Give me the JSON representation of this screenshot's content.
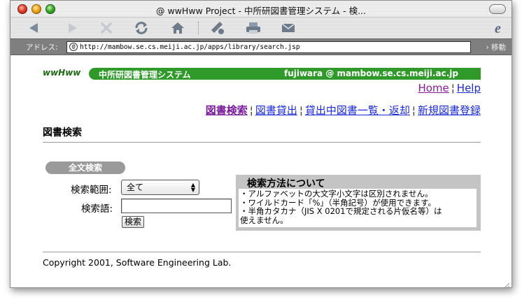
{
  "window": {
    "title": "@ wwHww Project - 中所研図書管理システム  - 検..."
  },
  "address": {
    "label": "アドレス:",
    "url": "http://mambow.se.cs.meiji.ac.jp/apps/library/search.jsp",
    "go_label": "› 移動"
  },
  "toolbar": {
    "icons": [
      "back-icon",
      "forward-icon",
      "stop-icon",
      "refresh-icon",
      "home-icon",
      "favorites-icon",
      "print-icon",
      "mail-icon",
      "ie-logo-icon"
    ]
  },
  "header": {
    "logo": "wwHww",
    "system_title": "中所研図書管理システム",
    "user": "fujiwara @ mambow.se.cs.meiji.ac.jp"
  },
  "top_links": {
    "home": "Home",
    "sep": "¦",
    "help": "Help"
  },
  "nav": {
    "sep": "¦",
    "items": [
      {
        "label": "図書検索"
      },
      {
        "label": "図書貸出"
      },
      {
        "label": "貸出中図書一覧・返却"
      },
      {
        "label": "新規図書登録"
      }
    ]
  },
  "page": {
    "title": "図書検索"
  },
  "search": {
    "section_label": "全文検索",
    "scope_label": "検索範囲:",
    "scope_value": "全て",
    "term_label": "検索語:",
    "term_value": "",
    "submit_label": "検索"
  },
  "help": {
    "title": "検索方法について",
    "lines": [
      "・アルファベットの大文字小文字は区別されません。",
      "・ワイルドカード「%」（半角記号）が使用できます。",
      "・半角カタカナ（JIS X 0201で規定される片仮名等）は",
      "使えません。"
    ]
  },
  "footer": {
    "copyright": "Copyright 2001, Software Engineering Lab."
  },
  "colors": {
    "brand_green": "#2f9a2a",
    "link_blue": "#1a2bd6",
    "visited_purple": "#7a1a9a"
  }
}
